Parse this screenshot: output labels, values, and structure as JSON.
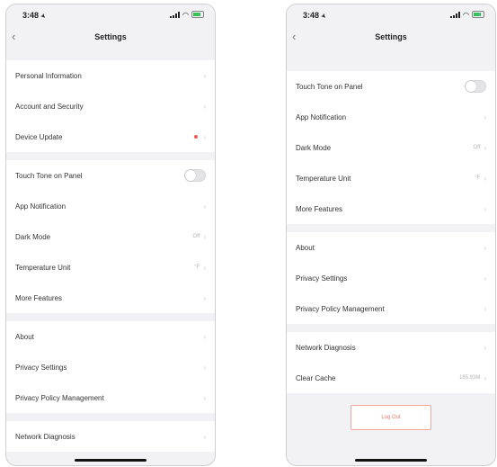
{
  "left": {
    "status_time": "3:48",
    "nav_title": "Settings",
    "section1": [
      {
        "label": "Personal Information"
      },
      {
        "label": "Account and Security"
      },
      {
        "label": "Device Update"
      }
    ],
    "section2": [
      {
        "label": "Touch Tone on Panel"
      },
      {
        "label": "App Notification"
      },
      {
        "label": "Dark Mode",
        "value": "Off"
      },
      {
        "label": "Temperature Unit",
        "value": "°F"
      },
      {
        "label": "More Features"
      }
    ],
    "section3": [
      {
        "label": "About"
      },
      {
        "label": "Privacy Settings"
      },
      {
        "label": "Privacy Policy Management"
      }
    ],
    "section4": [
      {
        "label": "Network Diagnosis"
      }
    ]
  },
  "right": {
    "status_time": "3:48",
    "nav_title": "Settings",
    "section1": [
      {
        "label": "Touch Tone on Panel"
      },
      {
        "label": "App Notification"
      },
      {
        "label": "Dark Mode",
        "value": "Off"
      },
      {
        "label": "Temperature Unit",
        "value": "°F"
      },
      {
        "label": "More Features"
      }
    ],
    "section2": [
      {
        "label": "About"
      },
      {
        "label": "Privacy Settings"
      },
      {
        "label": "Privacy Policy Management"
      }
    ],
    "section3": [
      {
        "label": "Network Diagnosis"
      },
      {
        "label": "Clear Cache",
        "value": "185.93M"
      }
    ],
    "logout_label": "Log Out"
  },
  "colors": {
    "background": "#f2f2f4",
    "logout_accent": "#ef7c6e",
    "update_dot": "#f25c54",
    "battery": "#38c35a"
  },
  "icons": [
    "back-chevron-icon",
    "chevron-right-icon",
    "signal-icon",
    "wifi-icon",
    "battery-icon",
    "location-arrow-icon"
  ]
}
